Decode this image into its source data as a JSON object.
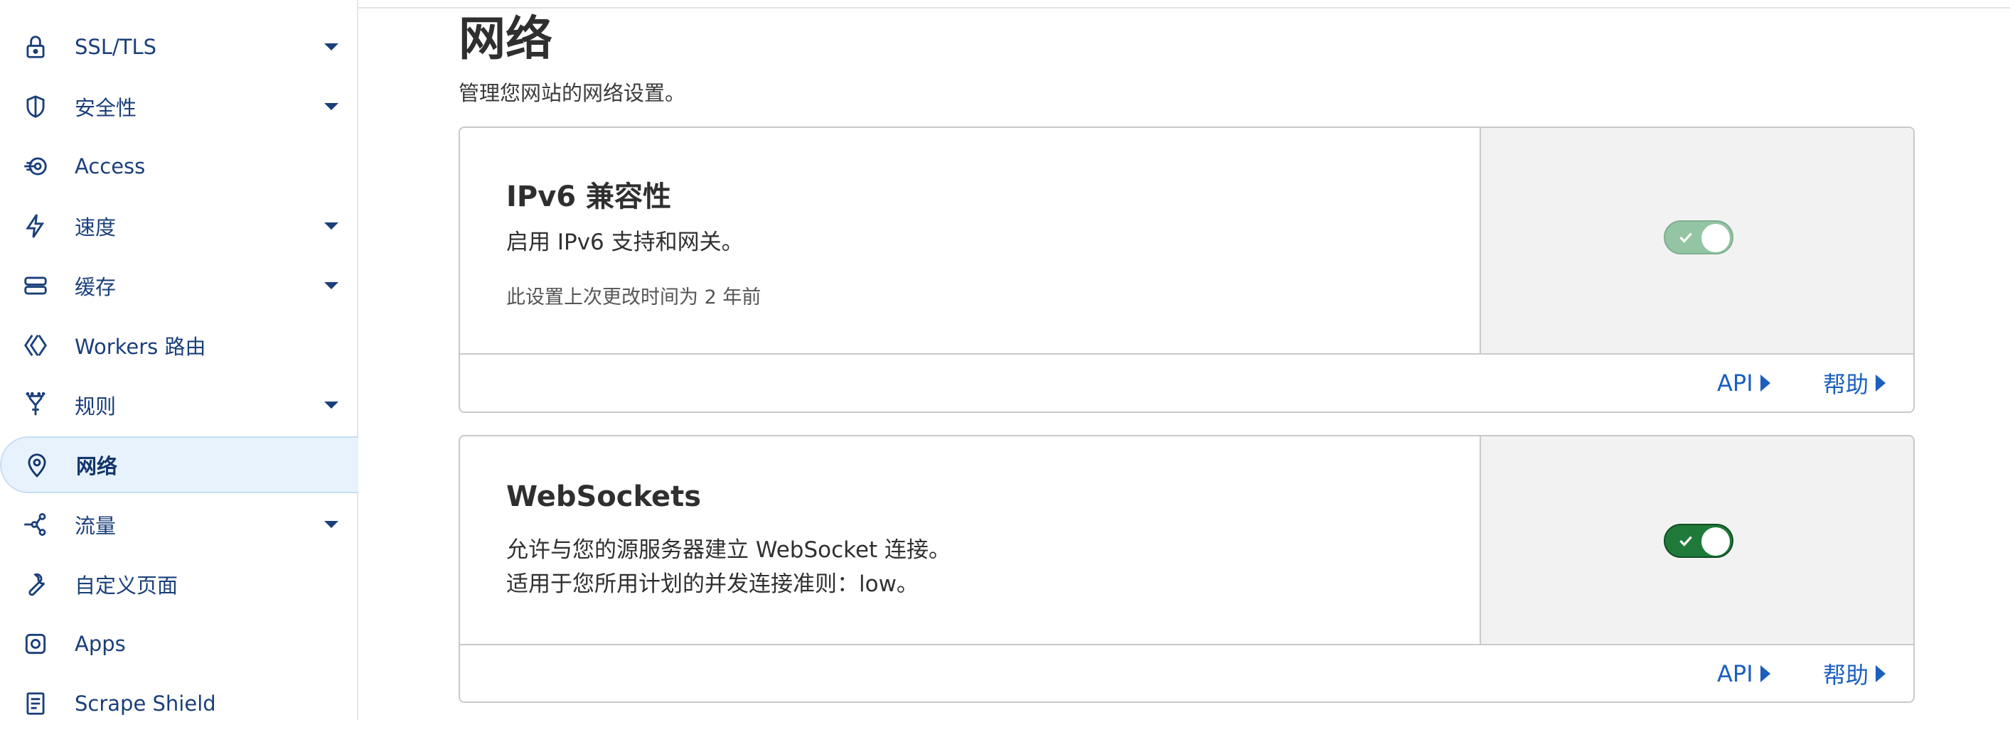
{
  "sidebar": {
    "items": [
      {
        "label": "SSL/TLS",
        "icon": "lock-icon",
        "has_caret": true
      },
      {
        "label": "安全性",
        "icon": "shield-icon",
        "has_caret": true
      },
      {
        "label": "Access",
        "icon": "access-icon",
        "has_caret": false
      },
      {
        "label": "速度",
        "icon": "lightning-icon",
        "has_caret": true
      },
      {
        "label": "缓存",
        "icon": "cache-stack-icon",
        "has_caret": true
      },
      {
        "label": "Workers 路由",
        "icon": "workers-icon",
        "has_caret": false
      },
      {
        "label": "规则",
        "icon": "rules-funnel-icon",
        "has_caret": true
      },
      {
        "label": "网络",
        "icon": "location-pin-icon",
        "has_caret": false,
        "active": true
      },
      {
        "label": "流量",
        "icon": "traffic-share-icon",
        "has_caret": true
      },
      {
        "label": "自定义页面",
        "icon": "wrench-icon",
        "has_caret": false
      },
      {
        "label": "Apps",
        "icon": "apps-icon",
        "has_caret": false
      },
      {
        "label": "Scrape Shield",
        "icon": "document-icon",
        "has_caret": false
      }
    ]
  },
  "page": {
    "title": "网络",
    "subtitle": "管理您网站的网络设置。"
  },
  "cards": [
    {
      "title": "IPv6 兼容性",
      "description": "启用 IPv6 支持和网关。",
      "meta": "此设置上次更改时间为 2 年前",
      "toggle_state": "on (disabled)",
      "api_label": "API",
      "help_label": "帮助"
    },
    {
      "title": "WebSockets",
      "description_line1": "允许与您的源服务器建立 WebSocket 连接。",
      "description_line2": "适用于您所用计划的并发连接准则：low。",
      "toggle_state": "on",
      "api_label": "API",
      "help_label": "帮助"
    }
  ],
  "colors": {
    "accent_link": "#1b5fbf",
    "nav_text": "#1a3f7a",
    "toggle_on": "#1f7a3a",
    "toggle_disabled": "#93c4a3",
    "active_nav_bg": "#e8f2fc"
  }
}
